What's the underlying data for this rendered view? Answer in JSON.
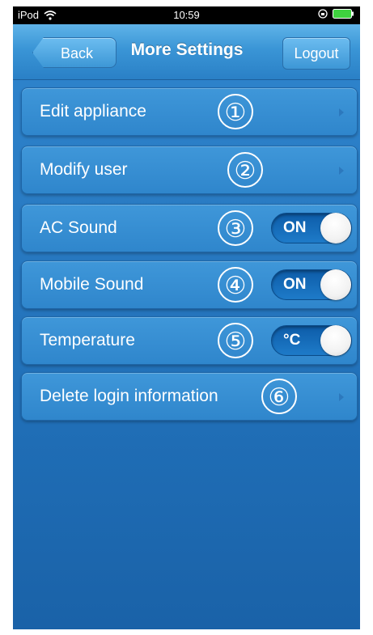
{
  "status_bar": {
    "carrier": "iPod",
    "time": "10:59"
  },
  "nav": {
    "back_label": "Back",
    "title": "More Settings",
    "logout_label": "Logout"
  },
  "rows": [
    {
      "label": "Edit appliance",
      "marker": "①",
      "type": "disclosure"
    },
    {
      "label": "Modify user",
      "marker": "②",
      "type": "disclosure"
    },
    {
      "label": "AC Sound",
      "marker": "③",
      "type": "toggle",
      "toggle_label": "ON",
      "state": "on"
    },
    {
      "label": "Mobile Sound",
      "marker": "④",
      "type": "toggle",
      "toggle_label": "ON",
      "state": "on"
    },
    {
      "label": "Temperature",
      "marker": "⑤",
      "type": "toggle",
      "toggle_label": "°C",
      "state": "on"
    },
    {
      "label": "Delete login information",
      "marker": "⑥",
      "type": "disclosure"
    }
  ],
  "colors": {
    "background": "#2a7cc4",
    "navbar": "#3a95d6",
    "toggle_on": "#1e7bc9"
  },
  "icons": [
    "wifi-icon",
    "lock-rotation-icon",
    "battery-icon",
    "chevron-right-icon"
  ]
}
